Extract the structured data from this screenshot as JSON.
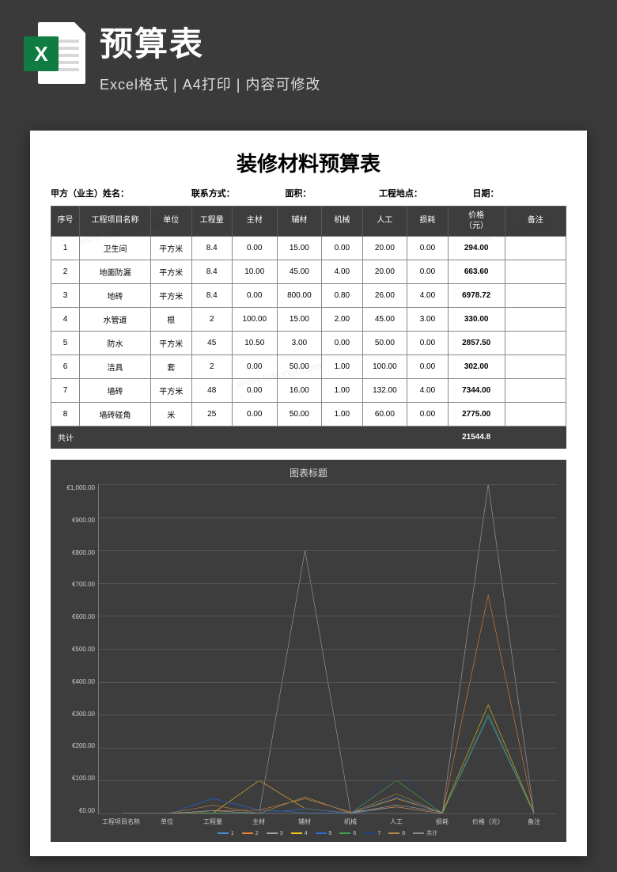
{
  "header": {
    "title": "预算表",
    "subtitle": "Excel格式 | A4打印 | 内容可修改",
    "badge": "X"
  },
  "doc": {
    "title": "装修材料预算表",
    "meta": {
      "owner": "甲方（业主）姓名：",
      "contact": "联系方式：",
      "area": "面积：",
      "location": "工程地点：",
      "date": "日期："
    }
  },
  "table": {
    "headers": [
      "序号",
      "工程项目名称",
      "单位",
      "工程量",
      "主材",
      "辅材",
      "机械",
      "人工",
      "损耗",
      "价格\n（元）",
      "备注"
    ],
    "rows": [
      {
        "no": "1",
        "name": "卫生间",
        "unit": "平方米",
        "qty": "8.4",
        "zhu": "0.00",
        "fu": "15.00",
        "ji": "0.00",
        "ren": "20.00",
        "sun": "0.00",
        "price": "294.00",
        "note": ""
      },
      {
        "no": "2",
        "name": "地面防漏",
        "unit": "平方米",
        "qty": "8.4",
        "zhu": "10.00",
        "fu": "45.00",
        "ji": "4.00",
        "ren": "20.00",
        "sun": "0.00",
        "price": "663.60",
        "note": ""
      },
      {
        "no": "3",
        "name": "地砖",
        "unit": "平方米",
        "qty": "8.4",
        "zhu": "0.00",
        "fu": "800.00",
        "ji": "0.80",
        "ren": "26.00",
        "sun": "4.00",
        "price": "6978.72",
        "note": ""
      },
      {
        "no": "4",
        "name": "水管道",
        "unit": "根",
        "qty": "2",
        "zhu": "100.00",
        "fu": "15.00",
        "ji": "2.00",
        "ren": "45.00",
        "sun": "3.00",
        "price": "330.00",
        "note": ""
      },
      {
        "no": "5",
        "name": "防水",
        "unit": "平方米",
        "qty": "45",
        "zhu": "10.50",
        "fu": "3.00",
        "ji": "0.00",
        "ren": "50.00",
        "sun": "0.00",
        "price": "2857.50",
        "note": ""
      },
      {
        "no": "6",
        "name": "洁具",
        "unit": "套",
        "qty": "2",
        "zhu": "0.00",
        "fu": "50.00",
        "ji": "1.00",
        "ren": "100.00",
        "sun": "0.00",
        "price": "302.00",
        "note": ""
      },
      {
        "no": "7",
        "name": "墙砖",
        "unit": "平方米",
        "qty": "48",
        "zhu": "0.00",
        "fu": "16.00",
        "ji": "1.00",
        "ren": "132.00",
        "sun": "4.00",
        "price": "7344.00",
        "note": ""
      },
      {
        "no": "8",
        "name": "墙砖碰角",
        "unit": "米",
        "qty": "25",
        "zhu": "0.00",
        "fu": "50.00",
        "ji": "1.00",
        "ren": "60.00",
        "sun": "0.00",
        "price": "2775.00",
        "note": ""
      }
    ],
    "total_label": "共计",
    "total_value": "21544.8"
  },
  "chart_data": {
    "type": "line",
    "title": "图表标题",
    "xlabel": "",
    "ylabel": "",
    "ylim": [
      0,
      1000
    ],
    "yticks": [
      "€1,000.00",
      "€900.00",
      "€800.00",
      "€700.00",
      "€600.00",
      "€500.00",
      "€400.00",
      "€300.00",
      "€200.00",
      "€100.00",
      "€0.00"
    ],
    "categories": [
      "工程项目名称",
      "单位",
      "工程量",
      "主材",
      "辅材",
      "机械",
      "人工",
      "损耗",
      "价格（元）",
      "备注"
    ],
    "series": [
      {
        "name": "1",
        "color": "#4a90d9",
        "values": [
          0,
          0,
          8.4,
          0,
          15,
          0,
          20,
          0,
          294,
          0
        ]
      },
      {
        "name": "2",
        "color": "#e8833a",
        "values": [
          0,
          0,
          8.4,
          10,
          45,
          4,
          20,
          0,
          663.6,
          0
        ]
      },
      {
        "name": "3",
        "color": "#9aa0a6",
        "values": [
          0,
          0,
          8.4,
          0,
          800,
          0.8,
          26,
          4,
          1000,
          0
        ]
      },
      {
        "name": "4",
        "color": "#f4c020",
        "values": [
          0,
          0,
          2,
          100,
          15,
          2,
          45,
          3,
          330,
          0
        ]
      },
      {
        "name": "5",
        "color": "#2e6bd6",
        "values": [
          0,
          0,
          45,
          10.5,
          3,
          0,
          50,
          0,
          1000,
          0
        ]
      },
      {
        "name": "6",
        "color": "#3aa757",
        "values": [
          0,
          0,
          2,
          0,
          50,
          1,
          100,
          0,
          302,
          0
        ]
      },
      {
        "name": "7",
        "color": "#204080",
        "values": [
          0,
          0,
          48,
          0,
          16,
          1,
          132,
          4,
          1000,
          0
        ]
      },
      {
        "name": "8",
        "color": "#b4874e",
        "values": [
          0,
          0,
          25,
          0,
          50,
          1,
          60,
          0,
          1000,
          0
        ]
      },
      {
        "name": "共计",
        "color": "#888888",
        "values": [
          0,
          0,
          0,
          0,
          0,
          0,
          0,
          0,
          1000,
          0
        ]
      }
    ],
    "legend_labels": [
      "1",
      "2",
      "3",
      "4",
      "5",
      "6",
      "7",
      "8",
      "共计"
    ]
  },
  "watermark": "www.tukuppt.com"
}
